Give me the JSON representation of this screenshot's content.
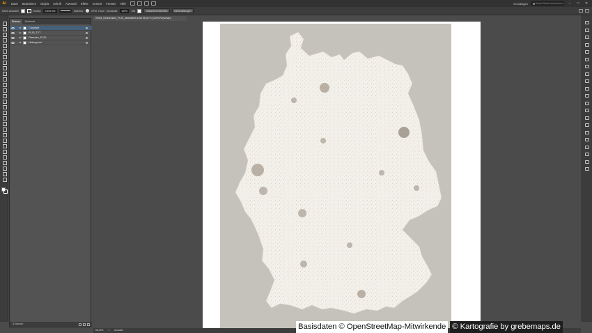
{
  "app": {
    "logo": "Ai"
  },
  "menu": [
    "Datei",
    "Bearbeiten",
    "Objekt",
    "Schrift",
    "Auswahl",
    "Effekt",
    "Ansicht",
    "Fenster",
    "Hilfe"
  ],
  "workspace": "Grundlagen",
  "search": {
    "placeholder": "Adobe Stock durchsuchen"
  },
  "window_controls": [
    "–",
    "□",
    "✕"
  ],
  "control_bar": {
    "selection": "Keine Auswahl",
    "stroke_label": "Kontur:",
    "stroke_value": "0,353 mm",
    "stroke_profile": "Gleichm.",
    "brush": "5 Pkt. Rund",
    "opacity_label": "Deckkraft:",
    "opacity_value": "100%",
    "style_label": "Stil:",
    "doc_setup": "Dokument einrichten",
    "preferences": "Voreinstellungen"
  },
  "layers_panel": {
    "tabs": [
      "Ebenen",
      "Zeichenfl."
    ],
    "layers": [
      {
        "name": "Copyright",
        "selected": true
      },
      {
        "name": "PLZ5_TXT",
        "selected": false
      },
      {
        "name": "Flaechen_PLZ5",
        "selected": false
      },
      {
        "name": "Hintergrund",
        "selected": false
      }
    ],
    "footer": "4 Ebenen"
  },
  "document_tab": "00004_Deutschland_PLZ5_abstrahiert.ai bei 58,45 % (CMYK/Vorschau)",
  "status_bar": {
    "zoom": "58,45%",
    "artboard": "1",
    "tool": "Auswahl"
  },
  "credits": {
    "left": "Basisdaten © OpenStreetMap-Mitwirkende",
    "right": "© Kartografie by grebemaps.de"
  },
  "colors": {
    "accent": "#ff9a00",
    "map_background": "#c5c1bb",
    "map_land": "#f3f0ea",
    "selection": "#46607a"
  }
}
